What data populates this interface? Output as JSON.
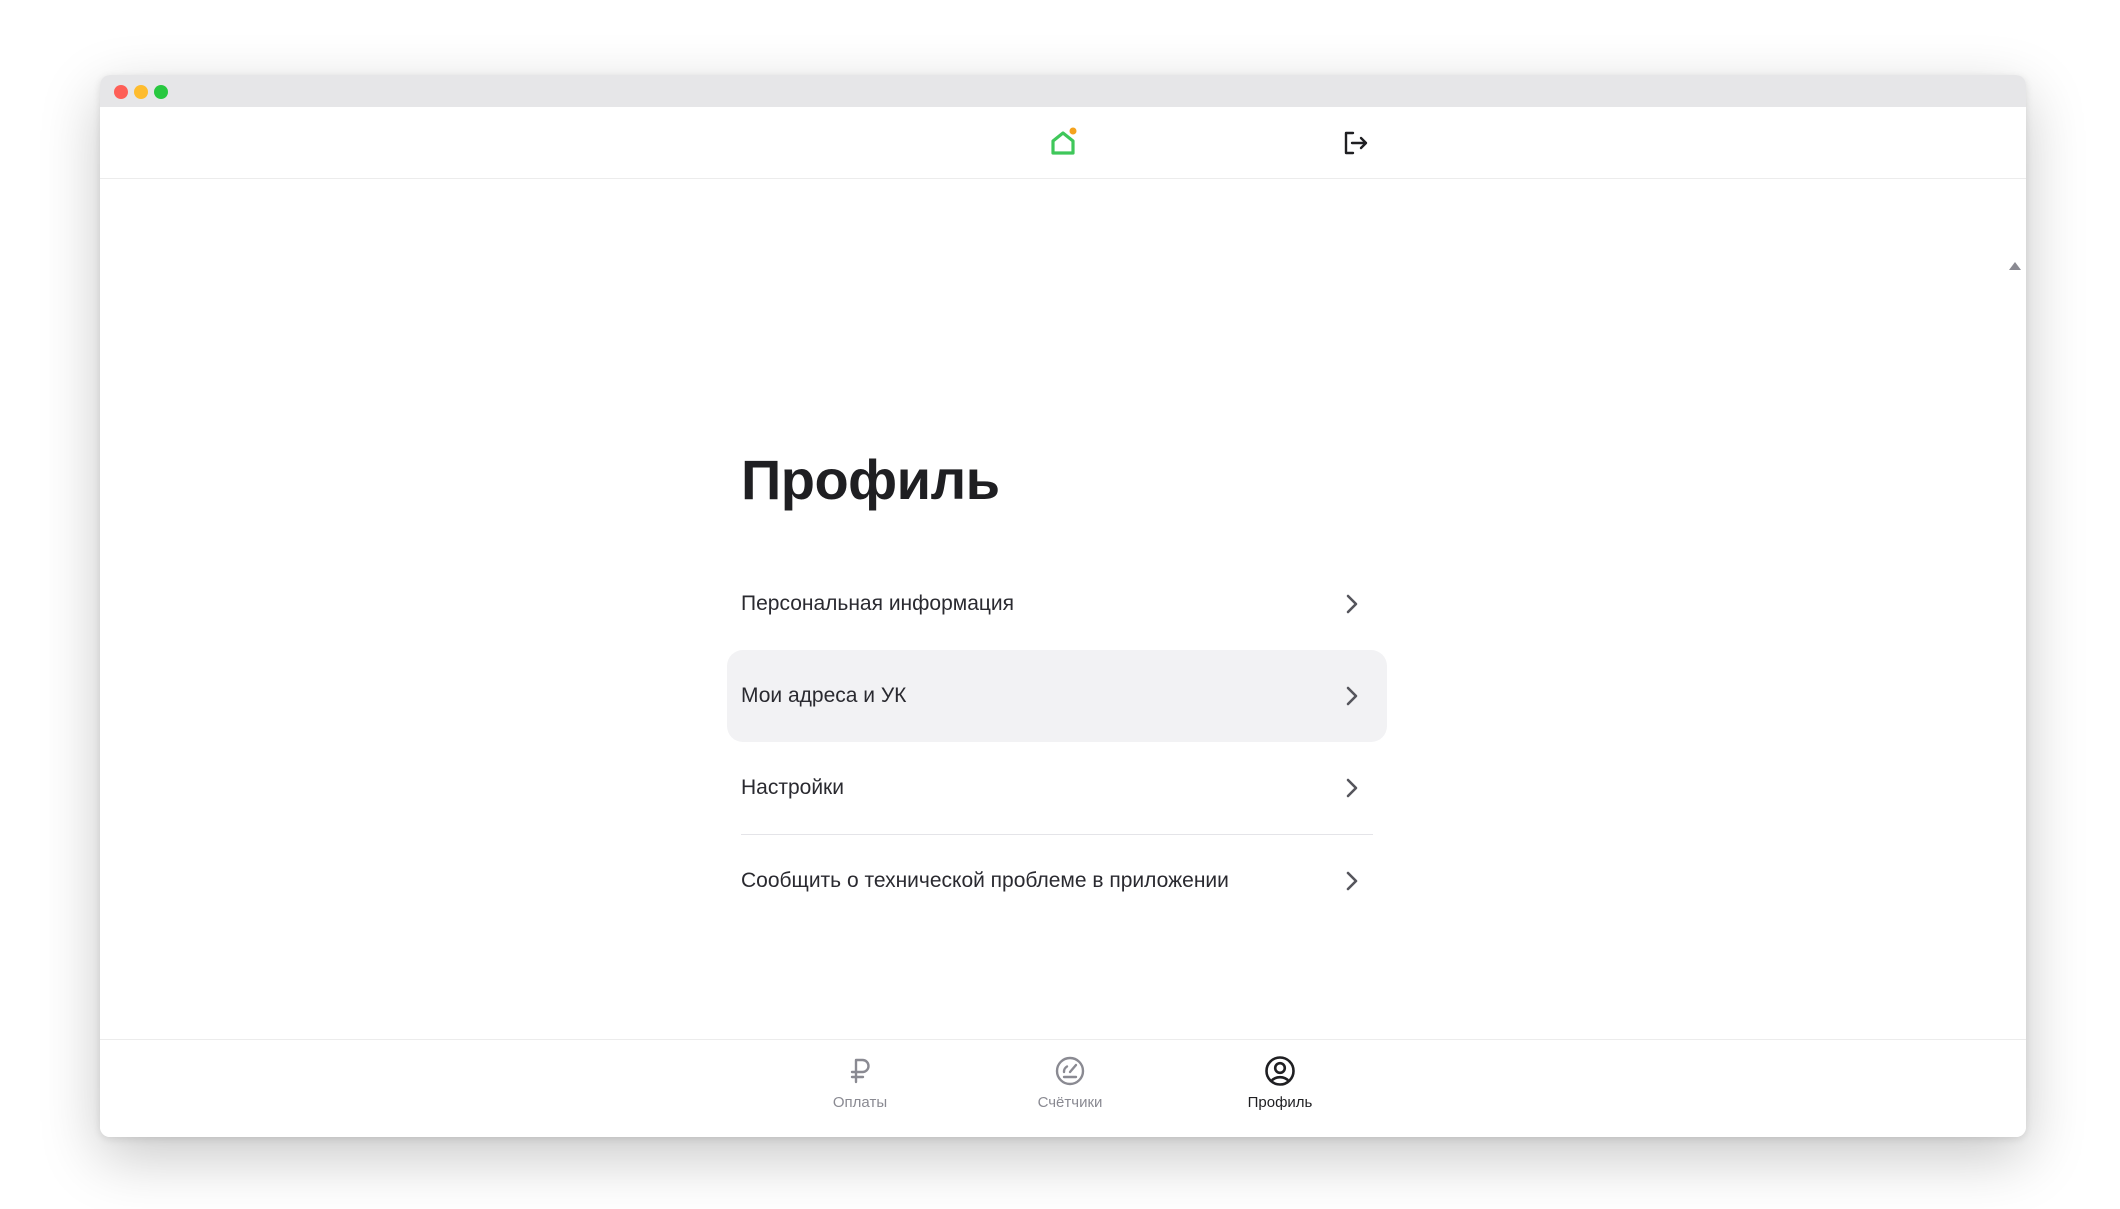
{
  "colors": {
    "accent": "#3fc75a",
    "badge": "#f4a21d",
    "text": "#1f1f22",
    "muted": "#8a8a92",
    "active_row_bg": "#f2f2f4"
  },
  "header": {
    "logo_icon": "house-icon",
    "logout_icon": "logout-icon"
  },
  "page": {
    "title": "Профиль"
  },
  "menu": {
    "items": [
      {
        "label": "Персональная информация",
        "icon": "chevron-right-icon"
      },
      {
        "label": "Мои адреса и УК",
        "icon": "chevron-right-icon",
        "active": true
      },
      {
        "label": "Настройки",
        "icon": "chevron-right-icon"
      },
      {
        "label": "Сообщить о технической проблеме в приложении",
        "icon": "chevron-right-icon"
      }
    ]
  },
  "tabbar": {
    "tabs": [
      {
        "label": "Оплаты",
        "icon": "ruble-icon"
      },
      {
        "label": "Счётчики",
        "icon": "meter-icon"
      },
      {
        "label": "Профиль",
        "icon": "user-circle-icon",
        "active": true
      }
    ]
  }
}
